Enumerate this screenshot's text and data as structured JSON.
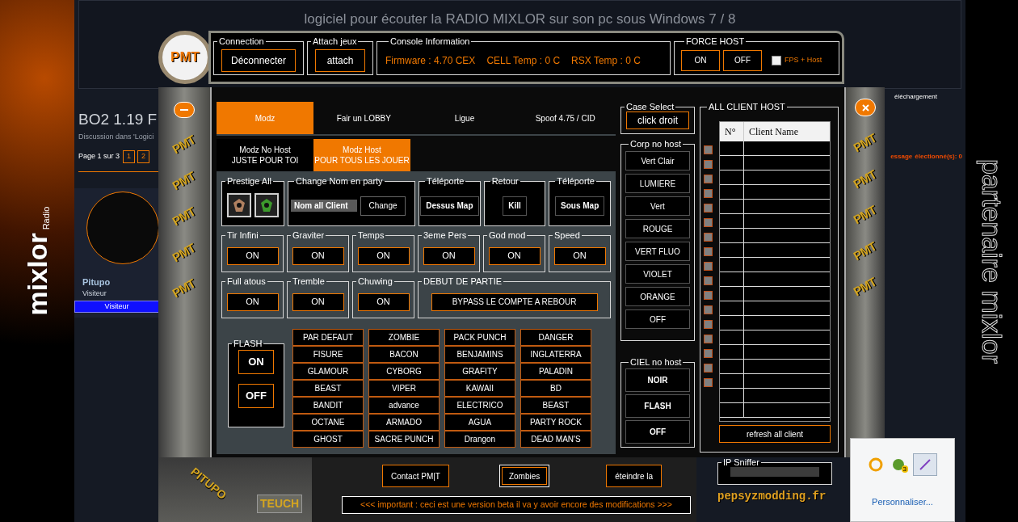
{
  "left_banner": {
    "logo": "mixlor",
    "sub": "Radio"
  },
  "right_banner": {
    "text": "partenaire mixlor"
  },
  "page": {
    "header_title": "logiciel pour écouter la RADIO MIXLOR sur son pc sous Windows 7 / 8",
    "top_link": "éléchargement",
    "thread_title": "BO2 1.19 F",
    "thread_meta": "Discussion dans 'Logici",
    "pagination": {
      "label": "Page 1 sur 3",
      "pages": [
        "1",
        "2"
      ]
    },
    "selection_fragments": [
      "essage",
      "électionné(s): 0"
    ],
    "user": {
      "name": "Pitupo",
      "title": "Visiteur",
      "badge": "Visiteur"
    }
  },
  "app": {
    "logo": "PMT",
    "connection": {
      "title": "Connection",
      "button": "Déconnecter"
    },
    "attach": {
      "title": "Attach  jeux",
      "button": "attach"
    },
    "console": {
      "title": "Console Information",
      "items": [
        "Firmware : 4.70 CEX",
        "CELL Temp : 0 C",
        "RSX Temp : 0 C"
      ]
    },
    "force_host": {
      "title": "FORCE HOST",
      "buttons": [
        "ON",
        "OFF"
      ],
      "checkbox": {
        "label": "FPS + Host",
        "checked": false
      }
    },
    "left_rail": [
      "PMT",
      "PMT",
      "PMT",
      "PMT",
      "PMT"
    ],
    "right_rail": [
      "PMT",
      "PMT",
      "PMT",
      "PMT",
      "PMT"
    ],
    "tabs": [
      {
        "label": "Modz",
        "selected": true
      },
      {
        "label": "Fair un LOBBY",
        "selected": false
      },
      {
        "label": "Ligue",
        "selected": false
      },
      {
        "label": "Spoof 4.75 / CID",
        "selected": false
      }
    ],
    "subtabs": [
      {
        "label": "Modz No Host",
        "sub": "JUSTE POUR TOI",
        "selected": false
      },
      {
        "label": "Modz Host",
        "sub": "POUR TOUS LES JOUER",
        "selected": true
      }
    ],
    "row1": [
      {
        "kind": "icons",
        "title": "Prestige All"
      },
      {
        "kind": "rename",
        "title": "Change Nom en party",
        "value": "Nom all Client",
        "button": "Change"
      },
      {
        "kind": "button",
        "title": "Téléporte",
        "button": "Dessus Map"
      },
      {
        "kind": "button",
        "title": "Retour",
        "button": "Kill"
      },
      {
        "kind": "button",
        "title": "Téléporte",
        "button": "Sous Map"
      }
    ],
    "row2": [
      {
        "kind": "toggle",
        "title": "Tir Infini",
        "button": "ON"
      },
      {
        "kind": "toggle",
        "title": "Graviter",
        "button": "ON"
      },
      {
        "kind": "toggle",
        "title": "Temps",
        "button": "ON"
      },
      {
        "kind": "toggle",
        "title": "3eme Pers",
        "button": "ON"
      },
      {
        "kind": "toggle",
        "title": "God mod",
        "button": "ON"
      },
      {
        "kind": "toggle",
        "title": "Speed",
        "button": "ON"
      }
    ],
    "row3": [
      {
        "kind": "toggle",
        "title": "Full atous",
        "button": "ON"
      },
      {
        "kind": "toggle",
        "title": "Tremble",
        "button": "ON"
      },
      {
        "kind": "toggle",
        "title": "Chuwing",
        "button": "ON"
      },
      {
        "kind": "wide",
        "title": "DEBUT DE PARTIE",
        "button": "BYPASS LE COMPTE A REBOUR"
      }
    ],
    "flash": {
      "title": "FLASH",
      "buttons": [
        "ON",
        "OFF"
      ]
    },
    "camo_columns": [
      [
        "PAR DEFAUT",
        "FISURE",
        "GLAMOUR",
        "BEAST",
        "BANDIT",
        "OCTANE",
        "GHOST"
      ],
      [
        "ZOMBIE",
        "BACON",
        "CYBORG",
        "VIPER",
        "advance",
        "ARMADO",
        "SACRE PUNCH"
      ],
      [
        "PACK PUNCH",
        "BENJAMINS",
        "GRAFITY",
        "KAWAII",
        "ELECTRICO",
        "AGUA",
        "Drangon"
      ],
      [
        "DANGER",
        "INGLATERRA",
        "PALADIN",
        "BD",
        "BEAST",
        "PARTY ROCK",
        "DEAD MAN'S"
      ]
    ],
    "case_select": {
      "title": "Case Select",
      "button": "click droit"
    },
    "corp_no_host": {
      "title": "Corp no host",
      "buttons": [
        "Vert Clair",
        "LUMIERE",
        "Vert",
        "ROUGE",
        "VERT FLUO",
        "VIOLET",
        "ORANGE",
        "OFF"
      ]
    },
    "ciel_no_host": {
      "title": "CIEL no host",
      "buttons": [
        "NOIR",
        "FLASH",
        "OFF"
      ]
    },
    "clients": {
      "title": "ALL CLIENT HOST",
      "columns": [
        "N°",
        "Client Name"
      ],
      "refresh": "refresh all client",
      "checkboxes": [
        {
          "checked": false
        },
        {
          "checked": false
        },
        {
          "checked": false
        },
        {
          "checked": false
        },
        {
          "checked": false
        },
        {
          "checked": false
        },
        {
          "checked": false
        },
        {
          "checked": false
        },
        {
          "checked": false
        },
        {
          "checked": false
        },
        {
          "checked": false
        },
        {
          "checked": false
        },
        {
          "checked": false
        },
        {
          "checked": false
        },
        {
          "checked": false
        },
        {
          "checked": false
        },
        {
          "checked": false
        }
      ]
    },
    "bottom_art": [
      "PITUPO",
      "TEUCH"
    ],
    "bottom_buttons": [
      {
        "label": "Contact PM|T",
        "selected": false
      },
      {
        "label": "Zombies",
        "selected": true
      },
      {
        "label": "éteindre la",
        "selected": false
      }
    ],
    "marquee": "<<< important : ceci est une version beta il va y avoir encore des modifications >>>",
    "ip_sniffer": {
      "title": "IP Sniffer"
    },
    "credit": "pepsyzmodding.fr"
  },
  "tray": {
    "badge": "3",
    "link": "Personnaliser..."
  }
}
